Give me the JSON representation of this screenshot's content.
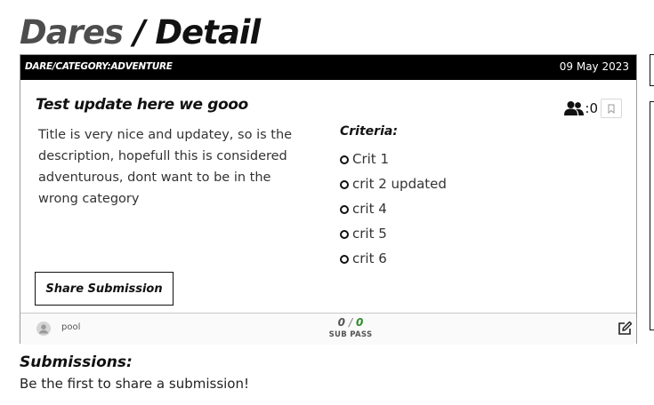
{
  "breadcrumb": {
    "parent": "Dares",
    "separator": "/",
    "current": "Detail"
  },
  "dare": {
    "category": "DARE/CATEGORY:ADVENTURE",
    "date": "09 May 2023",
    "title": "Test update here we gooo",
    "participant_count": ":0",
    "description": "Title is very nice and updatey, so is the description, hopefull this is considered adventurous, dont want to be in the wrong category",
    "criteria_heading": "Criteria:",
    "criteria": [
      "Crit 1",
      "crit 2 updated",
      "crit 4",
      "crit 5",
      "crit 6"
    ],
    "share_button_label": "Share Submission",
    "author": "pool",
    "stats": {
      "sub": "0",
      "separator": "/",
      "pass": "0",
      "sub_label": "SUB",
      "pass_label": "PASS"
    }
  },
  "submissions": {
    "heading": "Submissions:",
    "empty_message": "Be the first to share a submission!"
  },
  "icons": {
    "participants": "users-icon",
    "bookmark": "bookmark-icon",
    "avatar": "user-avatar-icon",
    "edit": "edit-icon"
  },
  "colors": {
    "header_bg": "#000000",
    "pass_green": "#2e8b2e",
    "breadcrumb_parent": "#4d4d4d"
  }
}
